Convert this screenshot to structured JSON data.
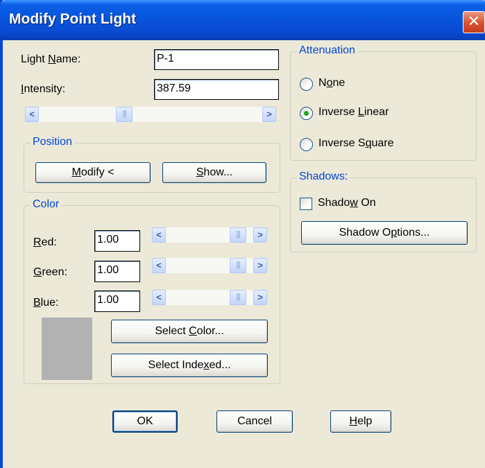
{
  "window": {
    "title": "Modify Point Light",
    "close_glyph": "✕"
  },
  "light_name": {
    "label_pre": "Light ",
    "label_accel": "N",
    "label_post": "ame:",
    "value": "P-1"
  },
  "intensity": {
    "label_pre": "",
    "label_accel": "I",
    "label_post": "ntensity:",
    "value": "387.59"
  },
  "position": {
    "title": "Position",
    "modify": {
      "pre": "",
      "accel": "M",
      "post": "odify <"
    },
    "show": {
      "pre": "",
      "accel": "S",
      "post": "how..."
    }
  },
  "color": {
    "title": "Color",
    "red": {
      "pre": "",
      "accel": "R",
      "post": "ed:",
      "value": "1.00"
    },
    "green": {
      "pre": "",
      "accel": "G",
      "post": "reen:",
      "value": "1.00"
    },
    "blue": {
      "pre": "",
      "accel": "B",
      "post": "lue:",
      "value": "1.00"
    },
    "swatch": "#b2b2b2",
    "select_color": {
      "pre": "Select ",
      "accel": "C",
      "post": "olor..."
    },
    "select_indexed": {
      "pre": "Select Inde",
      "accel": "x",
      "post": "ed..."
    }
  },
  "attenuation": {
    "title": "Attenuation",
    "options": [
      {
        "pre": "N",
        "accel": "o",
        "post": "ne",
        "selected": false
      },
      {
        "pre": "Inverse ",
        "accel": "L",
        "post": "inear",
        "selected": true
      },
      {
        "pre": "Inverse S",
        "accel": "q",
        "post": "uare",
        "selected": false
      }
    ]
  },
  "shadows": {
    "title": "Shadows:",
    "shadow_on": {
      "pre": "Shado",
      "accel": "w",
      "post": " On",
      "checked": false
    },
    "options_button": {
      "pre": "Shadow O",
      "accel": "p",
      "post": "tions..."
    }
  },
  "footer": {
    "ok": {
      "pre": "",
      "accel": "",
      "post": "OK"
    },
    "cancel": {
      "pre": "",
      "accel": "",
      "post": "Cancel"
    },
    "help": {
      "pre": "",
      "accel": "H",
      "post": "elp"
    }
  },
  "icons": {
    "scroll_left": "<",
    "scroll_right": ">",
    "thumb_grip": "|||"
  },
  "colors": {
    "title_bar": "#0855dd",
    "group_title": "#0046d5",
    "radio_dot": "#21a121",
    "close_button": "#d8502f"
  }
}
